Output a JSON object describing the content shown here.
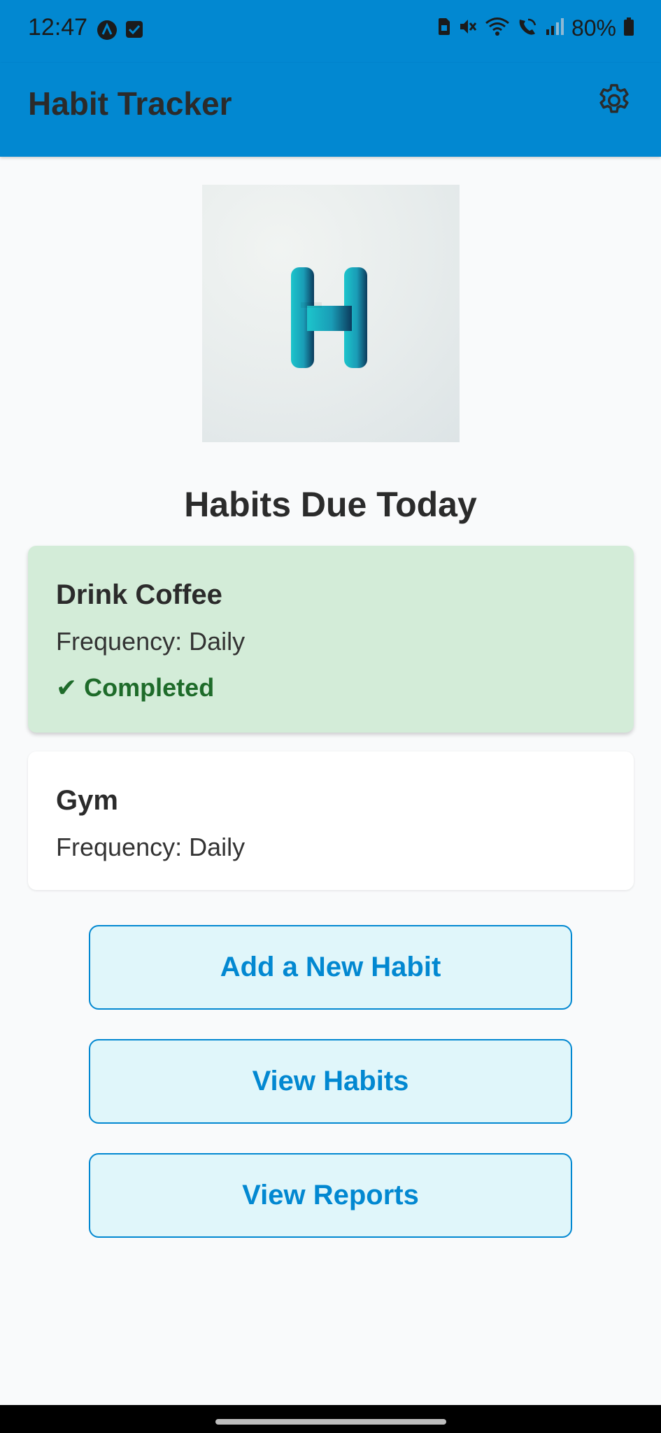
{
  "status_bar": {
    "time": "12:47",
    "battery": "80%",
    "icons": [
      "assistant-icon",
      "checkbox-notification-icon",
      "sim-card-icon",
      "mute-icon",
      "wifi-icon",
      "wifi-calling-icon",
      "signal-icon",
      "battery-icon"
    ]
  },
  "app_bar": {
    "title": "Habit Tracker",
    "settings_icon": "gear-icon"
  },
  "logo": {
    "letter": "H"
  },
  "main": {
    "section_title": "Habits Due Today",
    "habits": [
      {
        "name": "Drink Coffee",
        "frequency": "Frequency: Daily",
        "status": "✔ Completed",
        "completed": true
      },
      {
        "name": "Gym",
        "frequency": "Frequency: Daily",
        "completed": false
      }
    ],
    "buttons": {
      "add": "Add a New Habit",
      "view_habits": "View Habits",
      "view_reports": "View Reports"
    }
  },
  "colors": {
    "primary": "#0288d1",
    "completed_bg": "#d3ecd8",
    "completed_text": "#1e6b2a",
    "button_bg": "#e0f6fa"
  }
}
